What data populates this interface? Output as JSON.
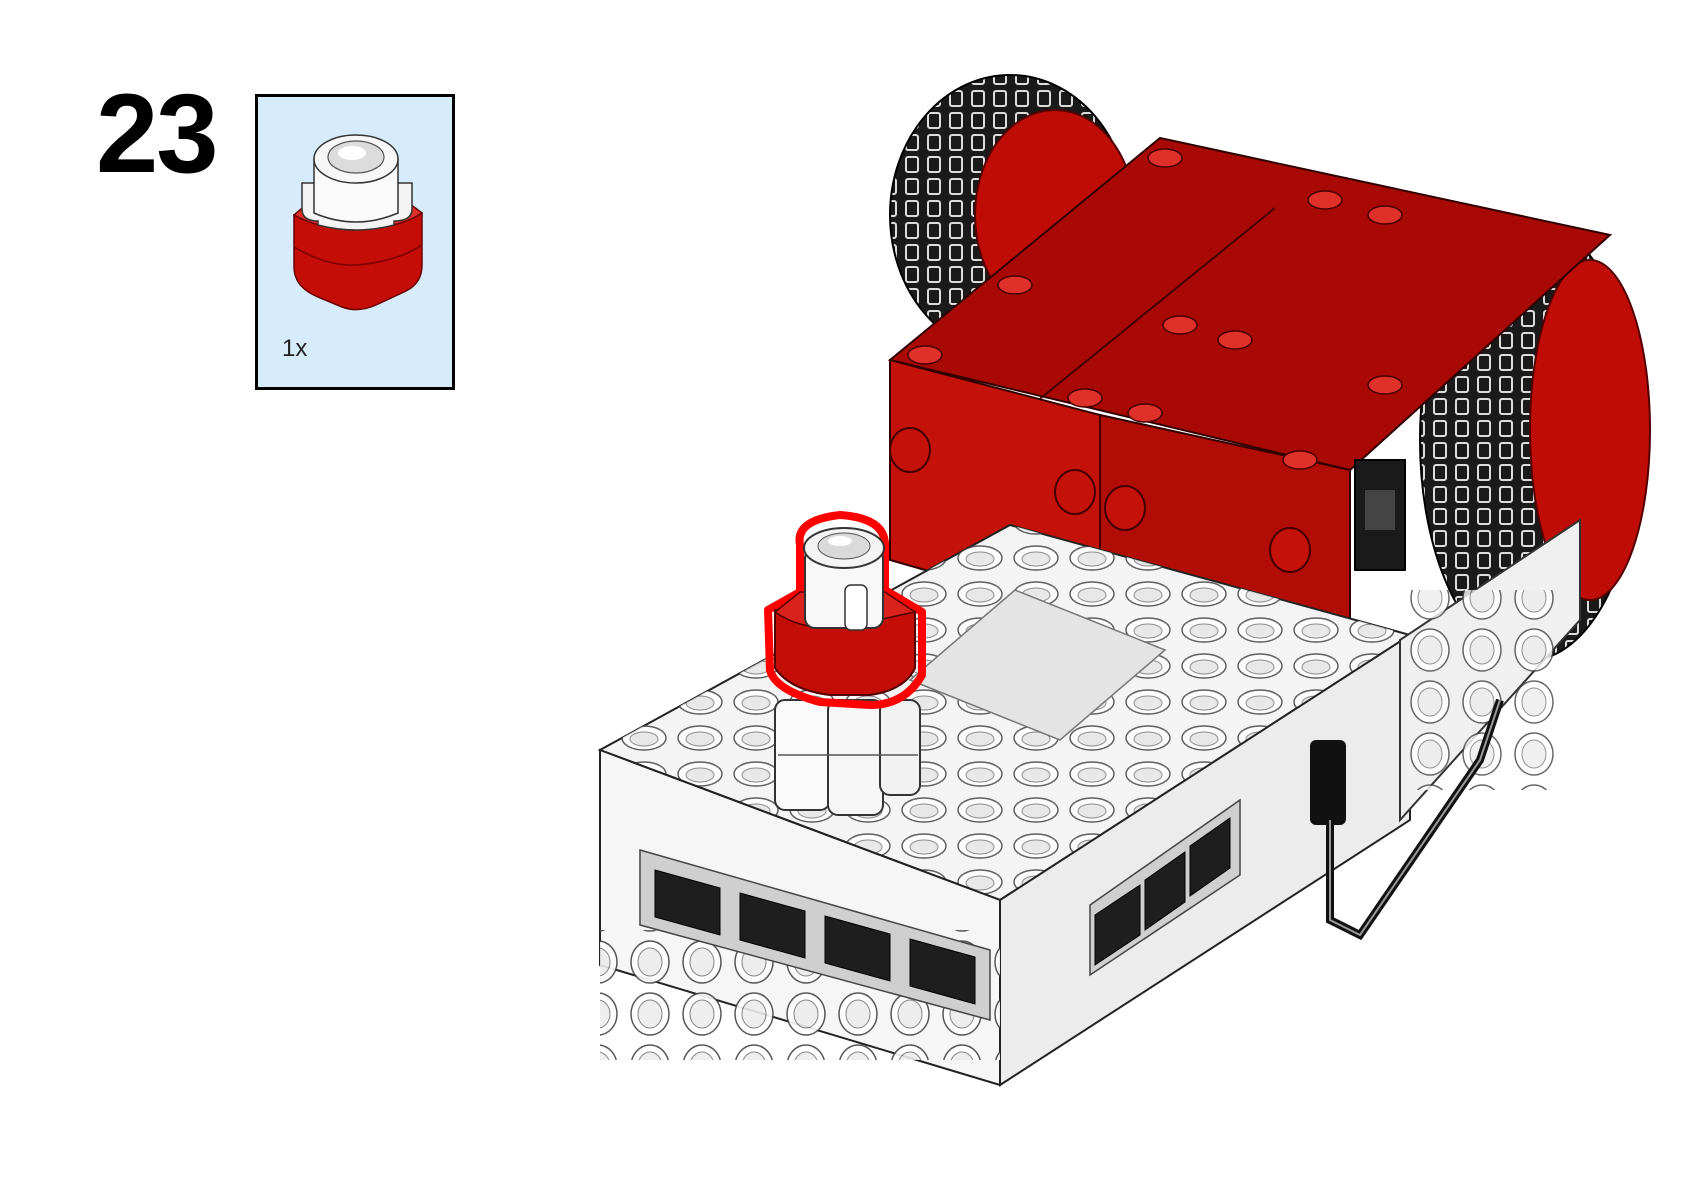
{
  "step": {
    "number": "23"
  },
  "parts_callout": {
    "quantity": "1x",
    "part_icon": "white-rubber-bumper-on-red-1x1-connector-icon",
    "background_color": "#d6ecfa"
  },
  "model": {
    "icon": "robot-assembly-illustration",
    "highlight_color": "#ff0000",
    "colors": {
      "red": "#b30a05",
      "white": "#f2f2f2",
      "tire": "#1a1a1a"
    }
  }
}
